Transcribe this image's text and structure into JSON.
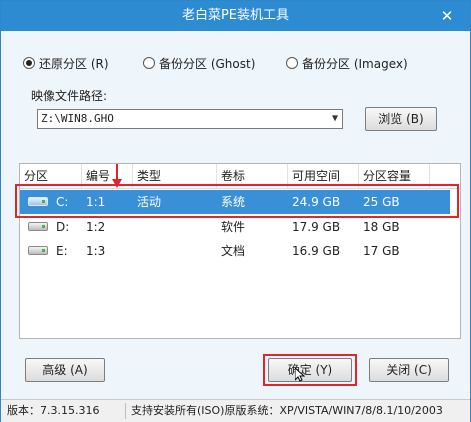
{
  "window": {
    "title": "老白菜PE装机工具",
    "close_glyph": "✕"
  },
  "modes": [
    {
      "label": "还原分区 (R)",
      "checked": true
    },
    {
      "label": "备份分区 (Ghost)",
      "checked": false
    },
    {
      "label": "备份分区 (Imagex)",
      "checked": false
    }
  ],
  "image_path": {
    "label": "映像文件路径:",
    "value": "Z:\\WIN8.GHO",
    "browse_label": "浏览 (B)"
  },
  "table": {
    "columns": [
      "分区",
      "编号",
      "类型",
      "卷标",
      "可用空间",
      "分区容量"
    ],
    "rows": [
      {
        "drive": "C:",
        "num": "1:1",
        "type": "活动",
        "label": "系统",
        "free": "24.9 GB",
        "size": "25 GB",
        "selected": true
      },
      {
        "drive": "D:",
        "num": "1:2",
        "type": "",
        "label": "软件",
        "free": "17.9 GB",
        "size": "18 GB",
        "selected": false
      },
      {
        "drive": "E:",
        "num": "1:3",
        "type": "",
        "label": "文档",
        "free": "16.9 GB",
        "size": "17 GB",
        "selected": false
      }
    ]
  },
  "buttons": {
    "advanced": "高级 (A)",
    "ok": "确定 (Y)",
    "close": "关闭 (C)"
  },
  "status": {
    "version": "版本：7.3.15.316",
    "support": "支持安装所有(ISO)原版系统：XP/VISTA/WIN7/8/8.1/10/2003"
  },
  "colors": {
    "titlebar": "#2d8bd2",
    "selection": "#3a90d7",
    "highlight_box": "#e0252b"
  }
}
